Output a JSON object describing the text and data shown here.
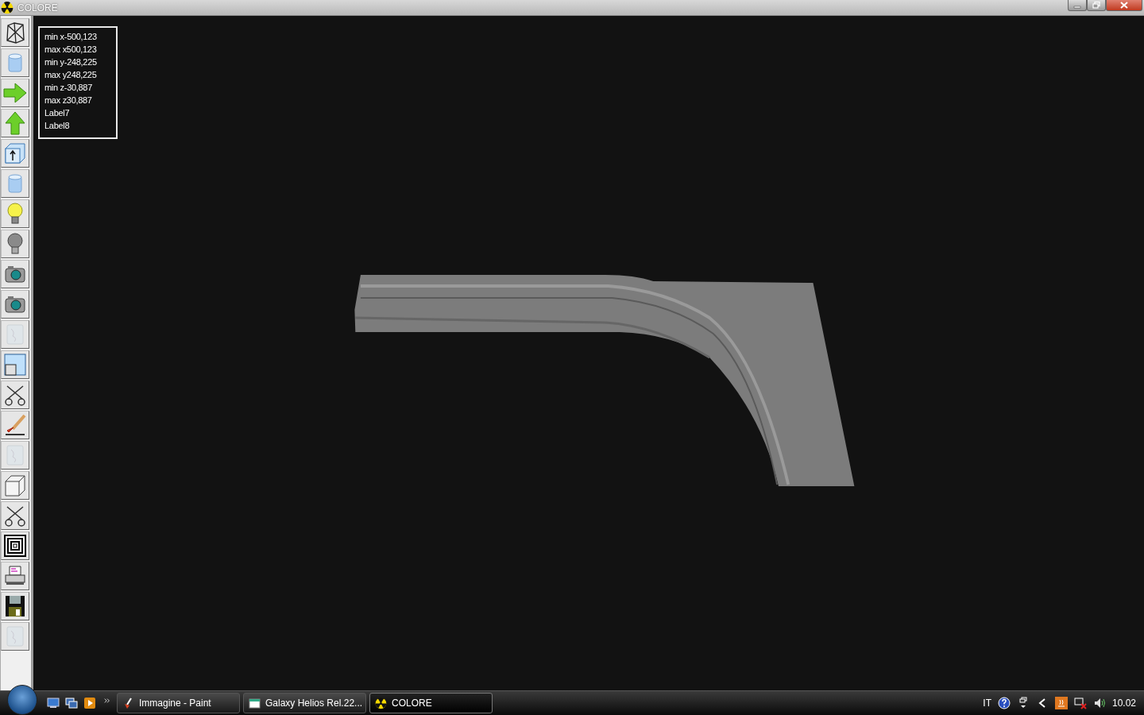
{
  "window": {
    "title": "COLORE"
  },
  "toolbar": [
    {
      "kind": "wireframe",
      "disabled": false
    },
    {
      "kind": "cylinder",
      "disabled": false
    },
    {
      "kind": "arrow-right",
      "disabled": false
    },
    {
      "kind": "arrow-up",
      "disabled": false
    },
    {
      "kind": "cube-arrow",
      "disabled": false
    },
    {
      "kind": "cylinder",
      "disabled": false
    },
    {
      "kind": "bulb-on",
      "disabled": false
    },
    {
      "kind": "bulb-off",
      "disabled": false
    },
    {
      "kind": "camera",
      "disabled": false
    },
    {
      "kind": "camera",
      "disabled": false
    },
    {
      "kind": "texture",
      "disabled": true
    },
    {
      "kind": "frame",
      "disabled": false
    },
    {
      "kind": "scissors",
      "disabled": false
    },
    {
      "kind": "brush",
      "disabled": false
    },
    {
      "kind": "texture",
      "disabled": true
    },
    {
      "kind": "cube",
      "disabled": false
    },
    {
      "kind": "scissors",
      "disabled": false
    },
    {
      "kind": "squares",
      "disabled": false
    },
    {
      "kind": "printer",
      "disabled": false
    },
    {
      "kind": "floppy",
      "disabled": false
    },
    {
      "kind": "texture",
      "disabled": true
    }
  ],
  "info_box": {
    "lines": [
      "min x-500,123",
      "max x500,123",
      "min y-248,225",
      "max y248,225",
      "min z-30,887",
      "max z30,887",
      "Label7",
      "Label8"
    ]
  },
  "taskbar": {
    "tasks": [
      {
        "label": "Immagine - Paint",
        "kind": "paint",
        "selected": false
      },
      {
        "label": "Galaxy Helios  Rel.22...",
        "kind": "app",
        "selected": false
      },
      {
        "label": "COLORE",
        "kind": "radiation",
        "selected": true
      }
    ],
    "language": "IT",
    "clock": "10.02"
  }
}
